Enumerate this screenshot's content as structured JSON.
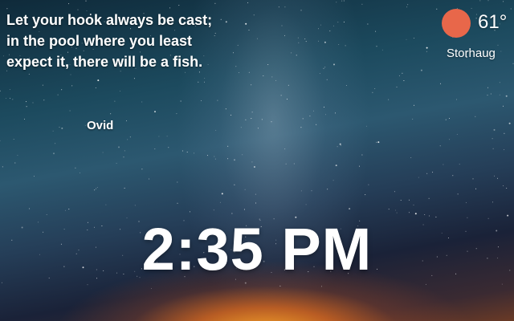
{
  "quote": {
    "text": "Let your hook always be cast; in the pool where you least expect it, there will be a fish.",
    "author": "Ovid"
  },
  "weather": {
    "temperature": "61°",
    "location": "Storhaug",
    "icon": "sun-icon",
    "icon_color": "#e8674a"
  },
  "clock": {
    "time": "2:35 PM"
  }
}
